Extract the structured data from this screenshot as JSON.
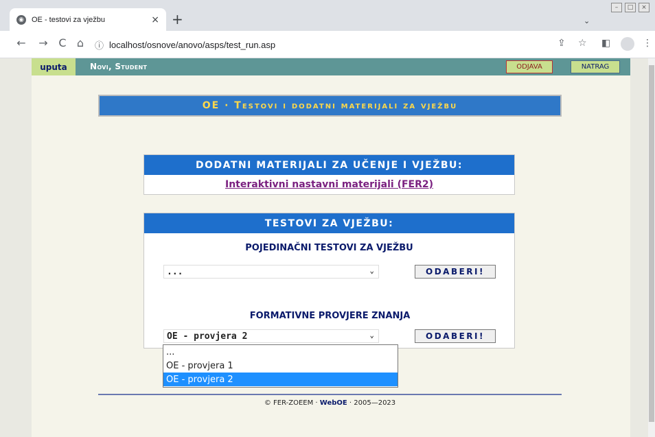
{
  "browser": {
    "tab_title": "OE - testovi za vježbu",
    "tab_close": "×",
    "new_tab": "+",
    "tab_search": "⌄",
    "url": "localhost/osnove/anovo/asps/test_run.asp",
    "back": "←",
    "forward": "→",
    "reload": "C",
    "home": "⌂",
    "info": "ⓘ",
    "share": "⇪",
    "star": "☆",
    "sidepanel": "◧",
    "menu": "⋮",
    "win_min": "–",
    "win_max": "□",
    "win_close": "⨯"
  },
  "topbar": {
    "uputa": "uputa",
    "user": "Novi, Student",
    "odjava": "ODJAVA",
    "natrag": "NATRAG"
  },
  "banner": "OE · Testovi i dodatni materijali za vježbu",
  "materials": {
    "heading": "DODATNI MATERIJALI ZA UČENJE I VJEŽBU:",
    "link": "Interaktivni nastavni materijali (FER2)"
  },
  "tests": {
    "heading": "TESTOVI ZA VJEŽBU:",
    "individual": {
      "label": "POJEDINAČNI TESTOVI ZA VJEŽBU",
      "selected": "...",
      "button": "ODABERI!"
    },
    "formative": {
      "label": "FORMATIVNE PROVJERE ZNANJA",
      "selected": "OE - provjera 2",
      "button": "ODABERI!",
      "options": [
        "...",
        "OE - provjera 1",
        "OE - provjera 2"
      ]
    }
  },
  "footer": {
    "prefix": "© FER-ZOEEM · ",
    "brand": "WebOE",
    "suffix": " · 2005—2023"
  },
  "colors": {
    "topbar": "#5e9696",
    "accent_green": "#c8df8e",
    "panel_head": "#1e6fcc",
    "banner_text": "#ffd84a",
    "selected_option": "#1e90ff"
  }
}
